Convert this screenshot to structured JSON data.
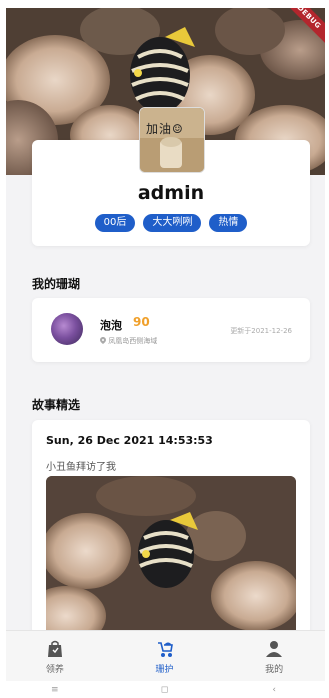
{
  "debug_banner": "DEBUG",
  "profile": {
    "avatar_text": "加油☺",
    "username": "admin",
    "tags": [
      "00后",
      "大大咧咧",
      "热情"
    ]
  },
  "my_coral": {
    "title": "我的珊瑚",
    "item": {
      "name": "泡泡",
      "score": "90",
      "location": "凤凰岛西侧海域",
      "updated": "更新于2021-12-26"
    }
  },
  "stories": {
    "title": "故事精选",
    "item": {
      "date": "Sun, 26 Dec 2021 14:53:53",
      "text": "小丑鱼拜访了我"
    }
  },
  "bottom_nav": {
    "items": [
      {
        "label": "领养",
        "icon": "bag-icon"
      },
      {
        "label": "珊护",
        "icon": "stroller-icon"
      },
      {
        "label": "我的",
        "icon": "person-icon"
      }
    ],
    "active_index": 1,
    "active_color": "#1f5ec9"
  },
  "system_nav": {
    "menu_glyph": "≡",
    "home_glyph": "◻",
    "back_glyph": "‹"
  },
  "colors": {
    "tag_blue": "#1f5ec9",
    "score_orange": "#f0a02b"
  }
}
